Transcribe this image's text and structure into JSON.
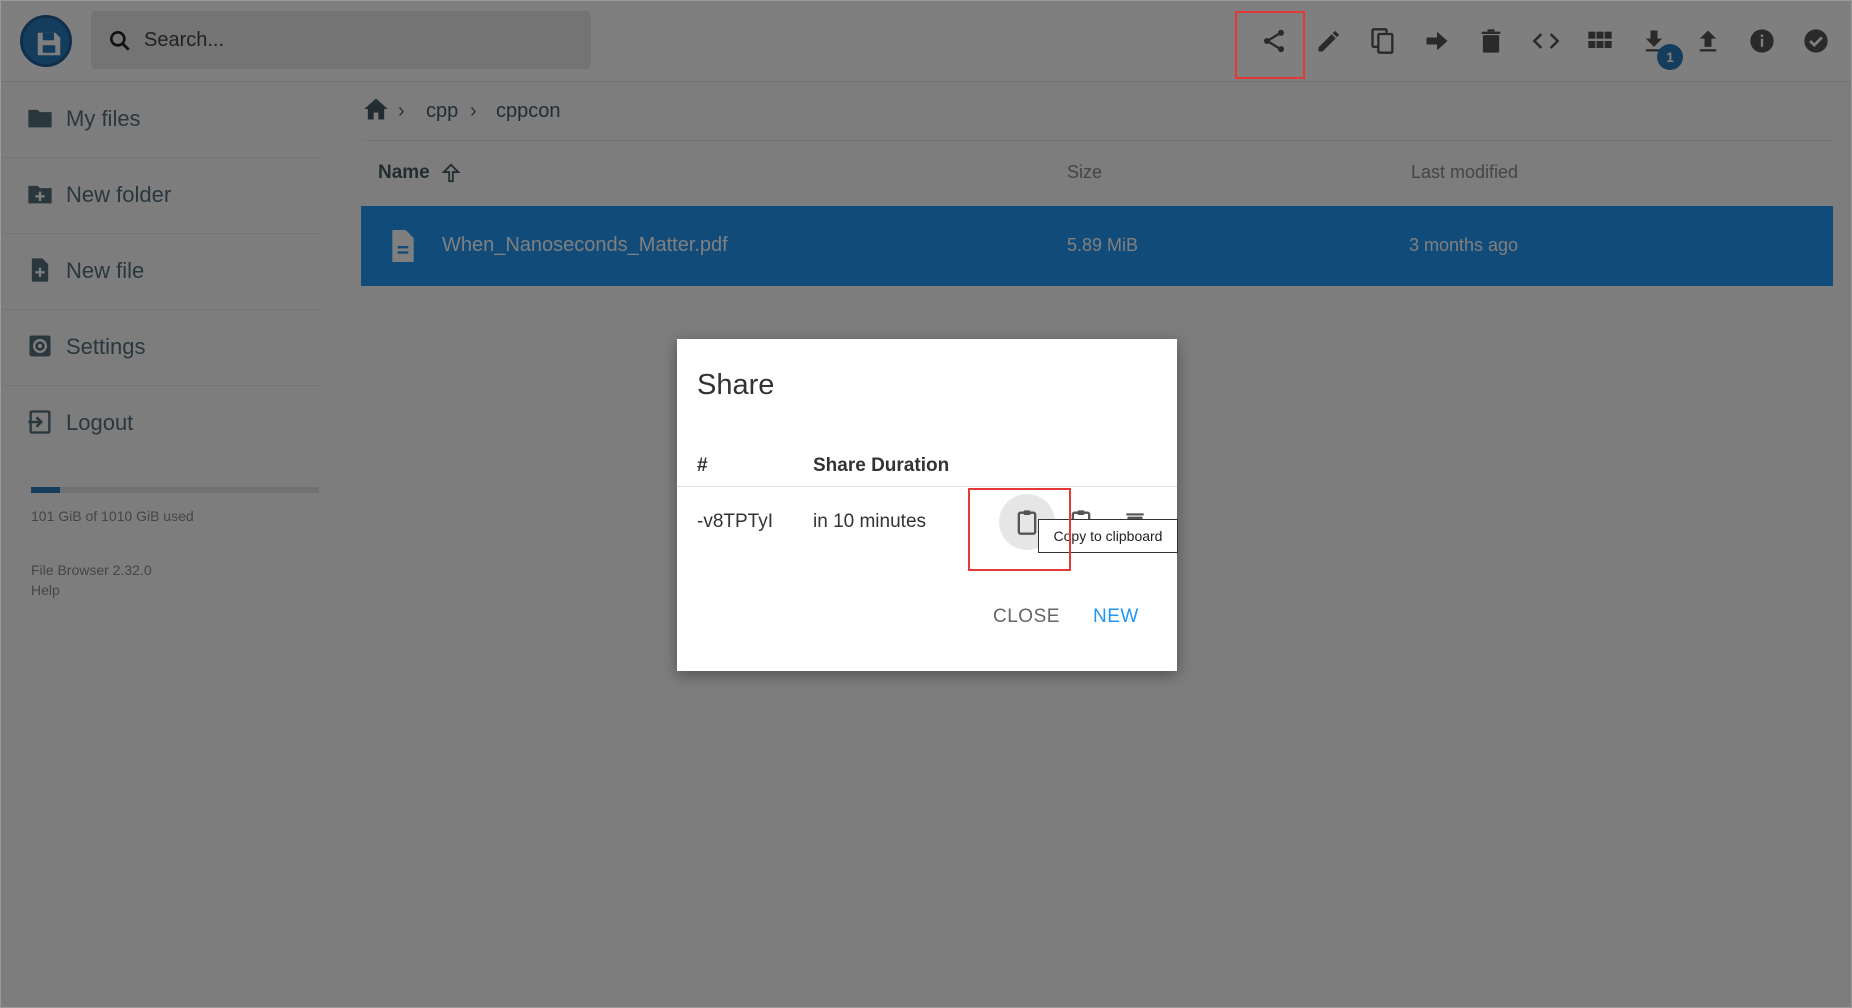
{
  "header": {
    "search_placeholder": "Search...",
    "toolbar": {
      "share": "share-icon",
      "rename": "pencil-icon",
      "copy": "copy-icon",
      "move": "arrow-right-icon",
      "delete": "trash-icon",
      "embed": "code-icon",
      "view": "grid-icon",
      "download": "download-icon",
      "download_badge": "1",
      "upload": "upload-icon",
      "info": "info-icon",
      "select": "check-circle-icon"
    }
  },
  "sidebar": {
    "items": [
      {
        "label": "My files",
        "icon": "folder-icon"
      },
      {
        "label": "New folder",
        "icon": "folder-plus-icon"
      },
      {
        "label": "New file",
        "icon": "file-plus-icon"
      },
      {
        "label": "Settings",
        "icon": "settings-icon"
      },
      {
        "label": "Logout",
        "icon": "logout-icon"
      }
    ],
    "usage_text": "101 GiB of 1010 GiB used",
    "usage_fraction": 0.1,
    "version": "File Browser 2.32.0",
    "help": "Help"
  },
  "breadcrumb": [
    "cpp",
    "cppcon"
  ],
  "file_list": {
    "headers": {
      "name": "Name",
      "size": "Size",
      "modified": "Last modified"
    },
    "rows": [
      {
        "name": "When_Nanoseconds_Matter.pdf",
        "size": "5.89 MiB",
        "modified": "3 months ago"
      }
    ]
  },
  "share_dialog": {
    "title": "Share",
    "col_hash": "#",
    "col_duration": "Share Duration",
    "share_id": "-v8TPTyI",
    "duration": "in 10 minutes",
    "tooltip": "Copy to clipboard",
    "close_label": "CLOSE",
    "new_label": "NEW"
  },
  "colors": {
    "accent": "#2196f3",
    "brand": "#2979b9",
    "highlight": "#e53935"
  }
}
